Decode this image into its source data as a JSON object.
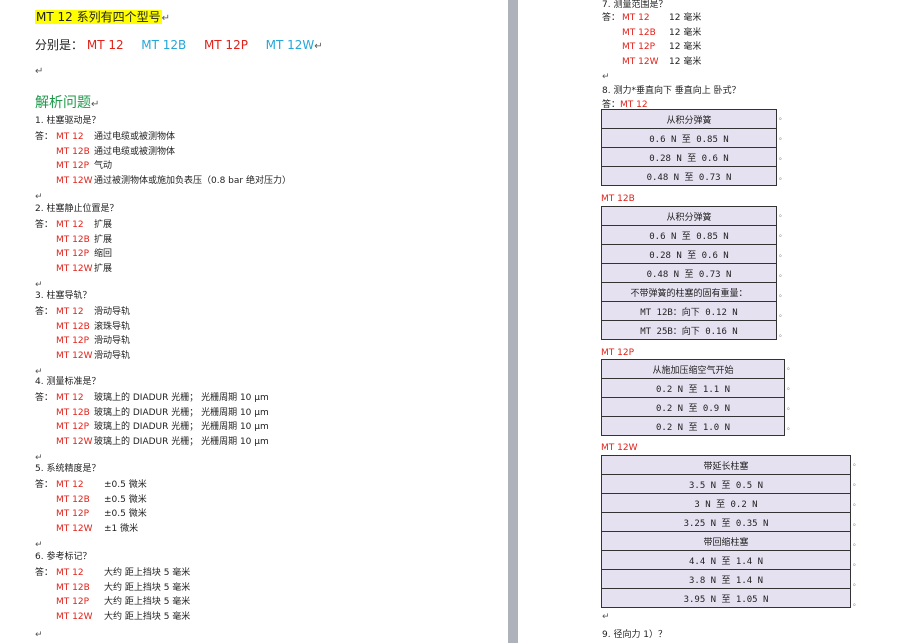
{
  "left": {
    "title": "MT 12 系列有四个型号",
    "models_prefix": "分别是：",
    "models": [
      {
        "label": "MT 12",
        "color": "red"
      },
      {
        "label": "MT 12B",
        "color": "blue"
      },
      {
        "label": "MT 12P",
        "color": "red"
      },
      {
        "label": "MT 12W",
        "color": "blue"
      }
    ],
    "section_heading": "解析问题",
    "questions": [
      {
        "q": "1.   柱塞驱动是？",
        "answers": [
          {
            "prefix": "答：",
            "model": "MT 12",
            "text": "通过电缆或被测物体"
          },
          {
            "prefix": "",
            "model": "MT 12B",
            "text": "通过电缆或被测物体"
          },
          {
            "prefix": "",
            "model": "MT 12P",
            "text": "气动"
          },
          {
            "prefix": "",
            "model": "MT 12W",
            "text": "通过被测物体或施加负表压（0.8  bar 绝对压力）"
          }
        ]
      },
      {
        "q": "2.   柱塞静止位置是？",
        "answers": [
          {
            "prefix": "答：",
            "model": "MT 12",
            "text": "扩展"
          },
          {
            "prefix": "",
            "model": "MT 12B",
            "text": "扩展"
          },
          {
            "prefix": "",
            "model": "MT 12P",
            "text": "缩回"
          },
          {
            "prefix": "",
            "model": "MT 12W",
            "text": "扩展"
          }
        ]
      },
      {
        "q": "3.   柱塞导轨？",
        "answers": [
          {
            "prefix": "答：",
            "model": "MT 12",
            "text": "滑动导轨"
          },
          {
            "prefix": "",
            "model": "MT 12B",
            "text": "滚珠导轨"
          },
          {
            "prefix": "",
            "model": "MT 12P",
            "text": "滑动导轨"
          },
          {
            "prefix": "",
            "model": "MT 12W",
            "text": "滑动导轨"
          }
        ]
      },
      {
        "q": "4.   测量标准是？",
        "answers": [
          {
            "prefix": "答：",
            "model": "MT 12",
            "text": "玻璃上的 DIADUR 光栅；  光栅周期 10 μm"
          },
          {
            "prefix": "",
            "model": "MT 12B",
            "text": "玻璃上的 DIADUR 光栅；  光栅周期 10 μm"
          },
          {
            "prefix": "",
            "model": "MT 12P",
            "text": "玻璃上的 DIADUR 光栅；  光栅周期 10 μm"
          },
          {
            "prefix": "",
            "model": "MT 12W",
            "text": "玻璃上的 DIADUR 光栅；  光栅周期 10 μm"
          }
        ]
      },
      {
        "q": "5.   系统精度是？",
        "answers": [
          {
            "prefix": "答：",
            "model": "MT 12",
            "text": "±0.5 微米"
          },
          {
            "prefix": "",
            "model": "MT 12B",
            "text": "±0.5 微米"
          },
          {
            "prefix": "",
            "model": "MT 12P",
            "text": "±0.5 微米"
          },
          {
            "prefix": "",
            "model": "MT 12W",
            "text": "±1 微米"
          }
        ]
      },
      {
        "q": "6.   参考标记？",
        "answers": [
          {
            "prefix": "答：",
            "model": "MT 12",
            "text": "大约  距上挡块 5 毫米"
          },
          {
            "prefix": "",
            "model": "MT 12B",
            "text": "大约  距上挡块 5 毫米"
          },
          {
            "prefix": "",
            "model": "MT 12P",
            "text": "大约  距上挡块 5 毫米"
          },
          {
            "prefix": "",
            "model": "MT 12W",
            "text": "大约  距上挡块 5 毫米"
          }
        ]
      }
    ]
  },
  "right": {
    "q7": "7.   测量范围是？",
    "q7_answers": [
      {
        "prefix": "答：",
        "model": "MT 12",
        "text": "12 毫米"
      },
      {
        "prefix": "",
        "model": "MT 12B",
        "text": "12 毫米"
      },
      {
        "prefix": "",
        "model": "MT 12P",
        "text": "12 毫米"
      },
      {
        "prefix": "",
        "model": "MT 12W",
        "text": "12 毫米"
      }
    ],
    "q8": "8.   测力*垂直向下  垂直向上  卧式？",
    "q8_prefix": "答：",
    "tables": [
      {
        "model": "MT 12",
        "rows": [
          "从积分弹簧",
          "0.6 N 至 0.85 N",
          "0.28 N 至 0.6 N",
          "0.48 N 至 0.73 N"
        ]
      },
      {
        "model": "MT 12B",
        "rows": [
          "从积分弹簧",
          "0.6 N 至 0.85 N",
          "0.28 N 至 0.6 N",
          "0.48 N 至 0.73 N",
          "不带弹簧的柱塞的固有重量：",
          "MT 12B：向下 0.12 N",
          "MT 25B：向下 0.16 N"
        ]
      },
      {
        "model": "MT 12P",
        "rows": [
          "从施加压缩空气开始",
          "0.2 N 至 1.1 N",
          "0.2 N 至 0.9 N",
          "0.2 N 至 1.0 N"
        ]
      },
      {
        "model": "MT 12W",
        "rows": [
          "带延长柱塞",
          "3.5 N 至 0.5 N",
          "3 N 至 0.2 N",
          "3.25 N 至 0.35 N",
          "带回缩柱塞",
          "4.4 N 至 1.4 N",
          "3.8 N 至 1.4 N",
          "3.95 N 至 1.05 N"
        ]
      }
    ],
    "q9": "9.   径向力 1）？"
  },
  "marks": {
    "paragraph": "↵",
    "cell": "。",
    "end": "，"
  },
  "colors": {
    "red": "#e0221a",
    "blue": "#27a7d8",
    "green": "#1f9a4b",
    "highlight": "#ffff00",
    "cell": "#e6e1f0",
    "gutter": "#aeb3bb"
  }
}
